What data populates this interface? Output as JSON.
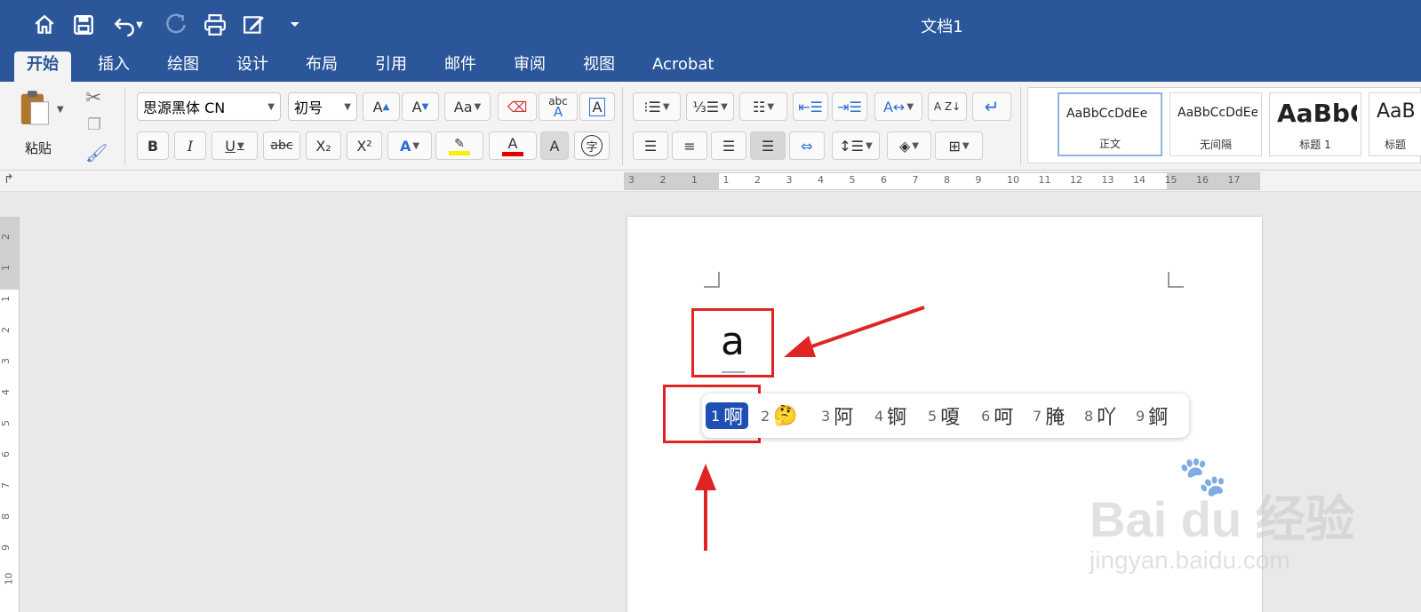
{
  "window": {
    "title": "文档1"
  },
  "quick_access": {
    "items": [
      "home-icon",
      "save-icon",
      "undo-icon",
      "redo-icon",
      "print-icon",
      "edit-icon",
      "customize-icon"
    ]
  },
  "tabs": [
    {
      "label": "开始",
      "active": true
    },
    {
      "label": "插入"
    },
    {
      "label": "绘图"
    },
    {
      "label": "设计"
    },
    {
      "label": "布局"
    },
    {
      "label": "引用"
    },
    {
      "label": "邮件"
    },
    {
      "label": "审阅"
    },
    {
      "label": "视图"
    },
    {
      "label": "Acrobat"
    }
  ],
  "ribbon": {
    "paste_label": "粘贴",
    "font_name": "思源黑体 CN",
    "font_size": "初号",
    "bold": "B",
    "italic": "I",
    "underline": "U",
    "strike": "abc",
    "subscript": "X₂",
    "superscript": "X²",
    "grow_font": "A",
    "shrink_font": "A",
    "change_case": "Aa",
    "phonetic": "abc",
    "char_border": "A",
    "text_effects": "A",
    "font_color": "A",
    "char_shading": "A",
    "enclose": "字",
    "sort": "A Z",
    "styles": [
      {
        "sample": "AaBbCcDdEe",
        "name": "正文",
        "selected": true
      },
      {
        "sample": "AaBbCcDdEe",
        "name": "无间隔"
      },
      {
        "sample": "AaBbC",
        "name": "标题 1"
      },
      {
        "sample": "AaB",
        "name": "标题"
      }
    ]
  },
  "ruler": {
    "h_labels": [
      "3",
      "2",
      "1",
      "1",
      "2",
      "3",
      "4",
      "5",
      "6",
      "7",
      "8",
      "9",
      "10",
      "11",
      "12",
      "13",
      "14",
      "15",
      "16",
      "17"
    ],
    "v_labels": [
      "2",
      "1",
      "1",
      "2",
      "3",
      "4",
      "5",
      "6",
      "7",
      "8",
      "9",
      "10"
    ]
  },
  "document": {
    "typed_text": "a"
  },
  "ime_candidates": [
    {
      "num": "1",
      "text": "啊",
      "selected": true
    },
    {
      "num": "2",
      "text": "🤔"
    },
    {
      "num": "3",
      "text": "阿"
    },
    {
      "num": "4",
      "text": "锕"
    },
    {
      "num": "5",
      "text": "嗄"
    },
    {
      "num": "6",
      "text": "呵"
    },
    {
      "num": "7",
      "text": "腌"
    },
    {
      "num": "8",
      "text": "吖"
    },
    {
      "num": "9",
      "text": "錒"
    }
  ],
  "watermark": {
    "logo": "Bai du 经验",
    "url": "jingyan.baidu.com"
  },
  "colors": {
    "brand": "#2b579a",
    "annotation_red": "#e02424",
    "ime_highlight": "#1d4fb4",
    "highlighter": "#ffee00",
    "font_red": "#e00000"
  }
}
